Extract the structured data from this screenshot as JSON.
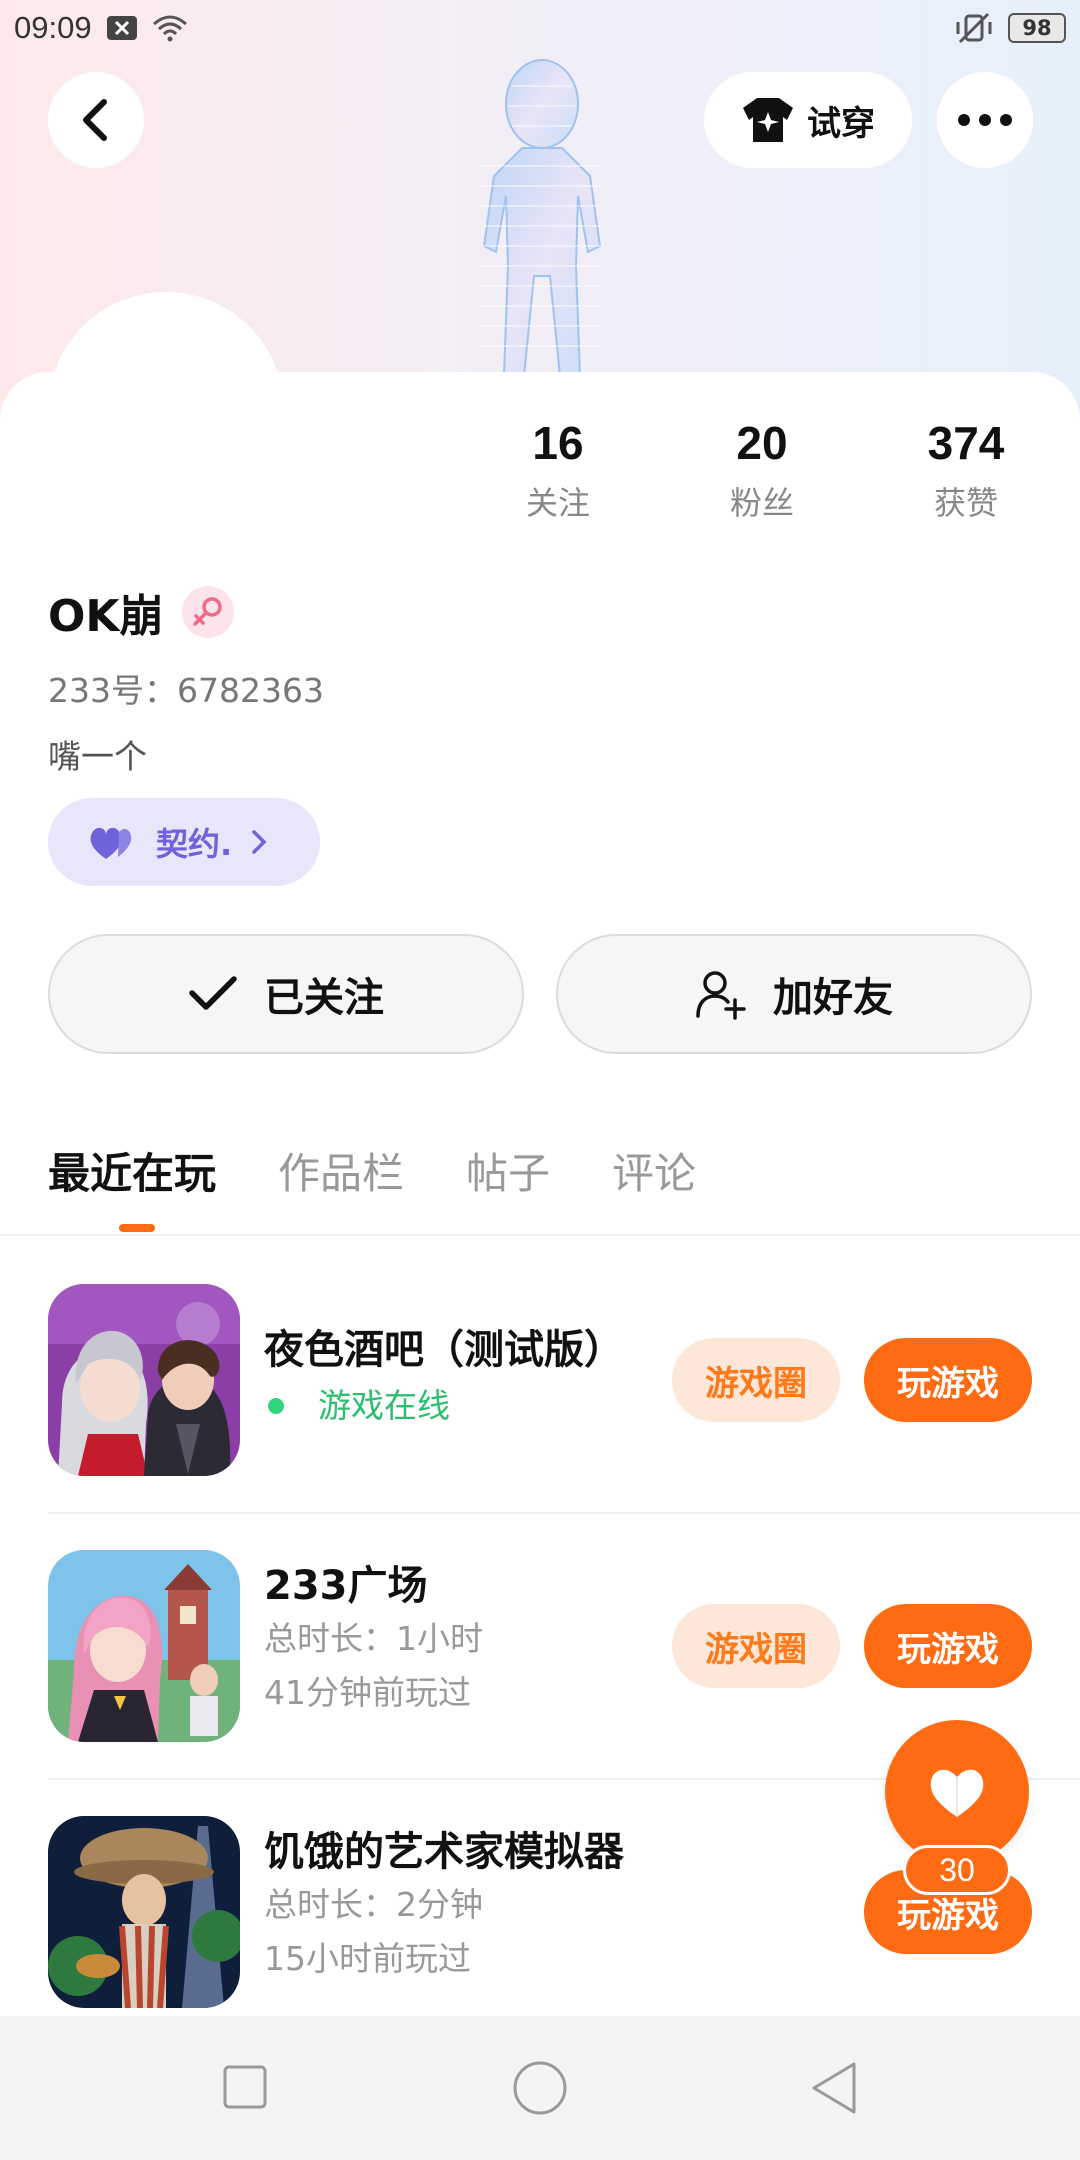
{
  "status_bar": {
    "time": "09:09",
    "battery": "98"
  },
  "header": {
    "try_on_label": "试穿"
  },
  "stats": [
    {
      "num": "16",
      "label": "关注"
    },
    {
      "num": "20",
      "label": "粉丝"
    },
    {
      "num": "374",
      "label": "获赞"
    }
  ],
  "profile": {
    "username": "OK崩",
    "uid": "233号：6782363",
    "bio": "嘴一个",
    "contract_label": "契约."
  },
  "actions": {
    "followed_label": "已关注",
    "add_friend_label": "加好友"
  },
  "tabs": [
    {
      "label": "最近在玩"
    },
    {
      "label": "作品栏"
    },
    {
      "label": "帖子"
    },
    {
      "label": "评论"
    }
  ],
  "games": [
    {
      "title": "夜色酒吧（测试版）",
      "status": "游戏在线",
      "circle_label": "游戏圈",
      "play_label": "玩游戏"
    },
    {
      "title": "233广场",
      "duration": "总时长：1小时",
      "last_played": "41分钟前玩过",
      "circle_label": "游戏圈",
      "play_label": "玩游戏"
    },
    {
      "title": "饥饿的艺术家模拟器",
      "duration": "总时长：2分钟",
      "last_played": "15小时前玩过",
      "play_label": "玩游戏"
    }
  ],
  "like_fab": {
    "count": "30"
  },
  "colors": {
    "accent": "#ff6b12",
    "online": "#2bbf6f",
    "contract": "#6f63d9"
  }
}
